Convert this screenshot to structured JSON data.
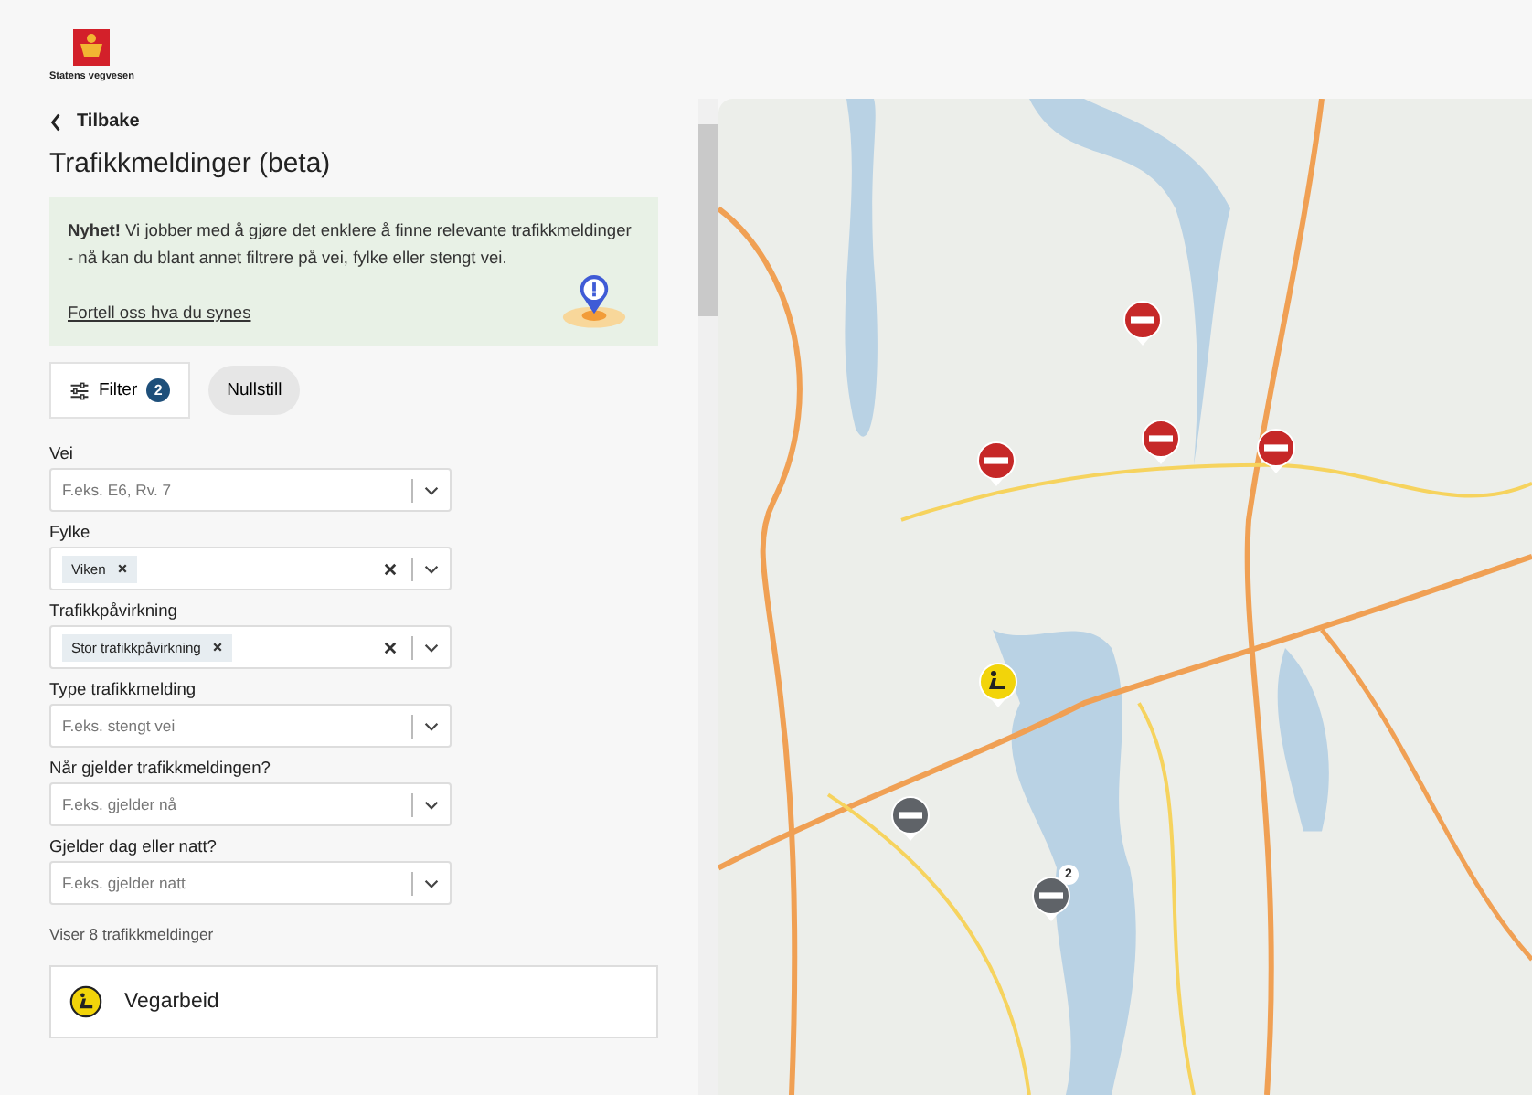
{
  "logo": {
    "text": "Statens vegvesen"
  },
  "back": {
    "label": "Tilbake"
  },
  "title": "Trafikkmeldinger (beta)",
  "notice": {
    "text": "**Nyhet!** Vi jobber med å gjøre det enklere å finne relevante trafikkmeldinger - nå kan du blant annet filtrere på vei, fylke eller stengt vei.",
    "link": "Fortell oss hva du synes"
  },
  "filter_button": {
    "label": "Filter",
    "count": "2"
  },
  "reset_button": {
    "label": "Nullstill"
  },
  "filters": [
    {
      "label": "Vei",
      "placeholder": "F.eks. E6, Rv. 7"
    },
    {
      "label": "Fylke",
      "chips": [
        "Viken"
      ]
    },
    {
      "label": "Trafikkpåvirkning",
      "chips": [
        "Stor trafikkpåvirkning"
      ]
    },
    {
      "label": "Type trafikkmelding",
      "placeholder": "F.eks. stengt vei"
    },
    {
      "label": "Når gjelder trafikkmeldingen?",
      "placeholder": "F.eks. gjelder nå"
    },
    {
      "label": "Gjelder dag eller natt?",
      "placeholder": "F.eks. gjelder natt"
    }
  ],
  "result_count": "Viser 8 trafikkmeldinger",
  "results": [
    {
      "kind": "roadwork",
      "title": "Vegarbeid"
    }
  ],
  "map": {
    "markers": [
      {
        "kind": "closed",
        "color": "#c62828"
      },
      {
        "kind": "closed",
        "color": "#c62828"
      },
      {
        "kind": "closed",
        "color": "#c62828"
      },
      {
        "kind": "closed",
        "color": "#c62828"
      },
      {
        "kind": "roadwork",
        "color": "#f2d40a"
      },
      {
        "kind": "closed",
        "color": "#5f6368"
      },
      {
        "kind": "closed",
        "color": "#5f6368",
        "count": "2"
      }
    ]
  }
}
